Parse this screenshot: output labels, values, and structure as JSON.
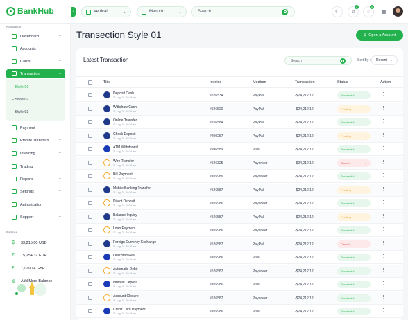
{
  "app": {
    "name": "BankHub"
  },
  "topbar": {
    "layout_select": "Vertical",
    "menu_select": "Menu 01",
    "search_placeholder": "Search",
    "notif_badge_1": "3",
    "notif_badge_2": "2"
  },
  "sidebar": {
    "nav_label": "Navigation",
    "items": [
      {
        "label": "Dashboard"
      },
      {
        "label": "Accounts"
      },
      {
        "label": "Cards"
      },
      {
        "label": "Transaction"
      },
      {
        "label": "Payment"
      },
      {
        "label": "Private Transfers"
      },
      {
        "label": "Invoicing"
      },
      {
        "label": "Trading"
      },
      {
        "label": "Reports"
      },
      {
        "label": "Settings"
      },
      {
        "label": "Authorization"
      },
      {
        "label": "Support"
      }
    ],
    "sub_items": [
      "Style 01",
      "Style 02",
      "Style 03"
    ],
    "balance_label": "Balance",
    "balances": [
      {
        "symbol": "$",
        "value": "33,215.00 USD"
      },
      {
        "symbol": "€",
        "value": "15,254.32 EUR"
      },
      {
        "symbol": "£",
        "value": "7,029.14 GBP"
      }
    ],
    "add_balance": "Add More Balance"
  },
  "page": {
    "title": "Transection Style 01",
    "open_account_button": "Open a Account"
  },
  "card": {
    "title": "Latest Transaction",
    "search_placeholder": "Search",
    "sort_label": "Sort By :",
    "sort_value": "Recent",
    "columns": [
      "Title",
      "Invoice",
      "Medium",
      "Transaction",
      "Status",
      "Action"
    ]
  },
  "colors": {
    "accent": "#22b14c",
    "paypal": "#1f3a8a",
    "visa": "#1a3bb8",
    "payoneer": "#f5a623",
    "successful_bg": "#e8f7ed",
    "successful_fg": "#22b14c",
    "pending_bg": "#fff4e0",
    "pending_fg": "#e8a33a",
    "cancel_bg": "#fde8ea",
    "cancel_fg": "#e5484d"
  },
  "transactions": [
    {
      "title": "Deposit Cash",
      "date": "11 Aug, 24. 10:36 am",
      "invoice": "#526534",
      "medium": "PayPal",
      "amount": "-$24,212.12",
      "status": "Successful"
    },
    {
      "title": "Withdraw Cash",
      "date": "11 Aug, 24. 10:36 am",
      "invoice": "#526520",
      "medium": "PayPal",
      "amount": "-$24,212.12",
      "status": "Pending"
    },
    {
      "title": "Online Transfer",
      "date": "11 Aug, 24. 10:36 am",
      "invoice": "#256584",
      "medium": "PayPal",
      "amount": "-$24,212.12",
      "status": "Successful"
    },
    {
      "title": "Check Deposit",
      "date": "11 Aug, 24. 10:36 am",
      "invoice": "#200257",
      "medium": "PayPal",
      "amount": "-$24,212.12",
      "status": "Pending"
    },
    {
      "title": "ATM Withdrawal",
      "date": "11 Aug, 24. 10:36 am",
      "invoice": "#996589",
      "medium": "Visa",
      "amount": "-$24,212.12",
      "status": "Successful"
    },
    {
      "title": "Wire Transfer",
      "date": "11 Aug, 24. 10:36 am",
      "invoice": "#526325",
      "medium": "Payoneer",
      "amount": "-$24,212.12",
      "status": "Cancel"
    },
    {
      "title": "Bill Payment",
      "date": "11 Aug, 24. 10:36 am",
      "invoice": "#105986",
      "medium": "Payoneer",
      "amount": "-$24,212.12",
      "status": "Successful"
    },
    {
      "title": "Mobile Banking Transfer",
      "date": "11 Aug, 24. 10:36 am",
      "invoice": "#526587",
      "medium": "PayPal",
      "amount": "-$24,212.12",
      "status": "Pending"
    },
    {
      "title": "Direct Deposit",
      "date": "11 Aug, 24. 10:36 am",
      "invoice": "#105986",
      "medium": "Payoneer",
      "amount": "-$24,212.12",
      "status": "Successful"
    },
    {
      "title": "Balance Inquiry",
      "date": "11 Aug, 24. 10:36 am",
      "invoice": "#526587",
      "medium": "PayPal",
      "amount": "-$24,212.12",
      "status": "Pending"
    },
    {
      "title": "Loan Payment",
      "date": "11 Aug, 24. 10:36 am",
      "invoice": "#105986",
      "medium": "Payoneer",
      "amount": "-$24,212.12",
      "status": "Successful"
    },
    {
      "title": "Foreign Currency Exchange",
      "date": "11 Aug, 24. 10:36 am",
      "invoice": "#526587",
      "medium": "PayPal",
      "amount": "-$24,212.12",
      "status": "Cancel"
    },
    {
      "title": "Overdraft Fee",
      "date": "11 Aug, 24. 10:36 am",
      "invoice": "#105986",
      "medium": "Visa",
      "amount": "-$24,212.12",
      "status": "Successful"
    },
    {
      "title": "Automatic Debit",
      "date": "11 Aug, 24. 10:36 am",
      "invoice": "#526587",
      "medium": "Payoneer",
      "amount": "-$24,212.12",
      "status": "Successful"
    },
    {
      "title": "Interest Deposit",
      "date": "11 Aug, 24. 10:36 am",
      "invoice": "#105986",
      "medium": "Visa",
      "amount": "-$24,212.12",
      "status": "Successful"
    },
    {
      "title": "Account Closure",
      "date": "11 Aug, 24. 10:36 am",
      "invoice": "#526587",
      "medium": "Payoneer",
      "amount": "-$24,212.12",
      "status": "Successful"
    },
    {
      "title": "Credit Card Payment",
      "date": "11 Aug, 24. 10:36 am",
      "invoice": "#105986",
      "medium": "Visa",
      "amount": "-$24,212.12",
      "status": "Successful"
    }
  ]
}
